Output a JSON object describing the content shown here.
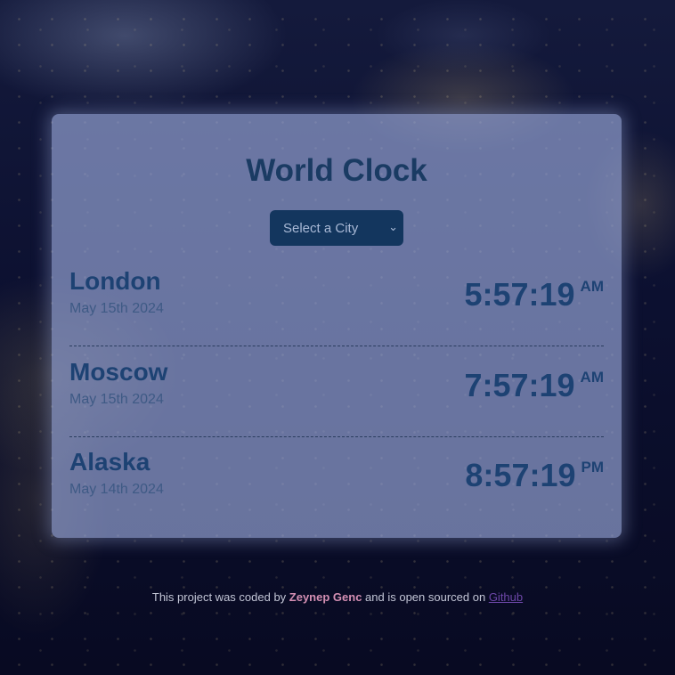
{
  "header": {
    "title": "World Clock"
  },
  "city_select": {
    "placeholder": "Select a City",
    "chevron_icon": "chevron-down-icon"
  },
  "cities": [
    {
      "name": "London",
      "date": "May 15th 2024",
      "time": "5:57:19",
      "ampm": "AM"
    },
    {
      "name": "Moscow",
      "date": "May 15th 2024",
      "time": "7:57:19",
      "ampm": "AM"
    },
    {
      "name": "Alaska",
      "date": "May 14th 2024",
      "time": "8:57:19",
      "ampm": "PM"
    }
  ],
  "footer": {
    "prefix": "This project was coded by ",
    "author": "Zeynep Genc",
    "middle": " and is open sourced on ",
    "link_label": "Github"
  },
  "colors": {
    "card_bg": "#96a5d7",
    "text_primary": "#1d4273",
    "select_bg": "#13365e",
    "author_color": "#d48fb3",
    "link_color": "#6d47a8"
  }
}
